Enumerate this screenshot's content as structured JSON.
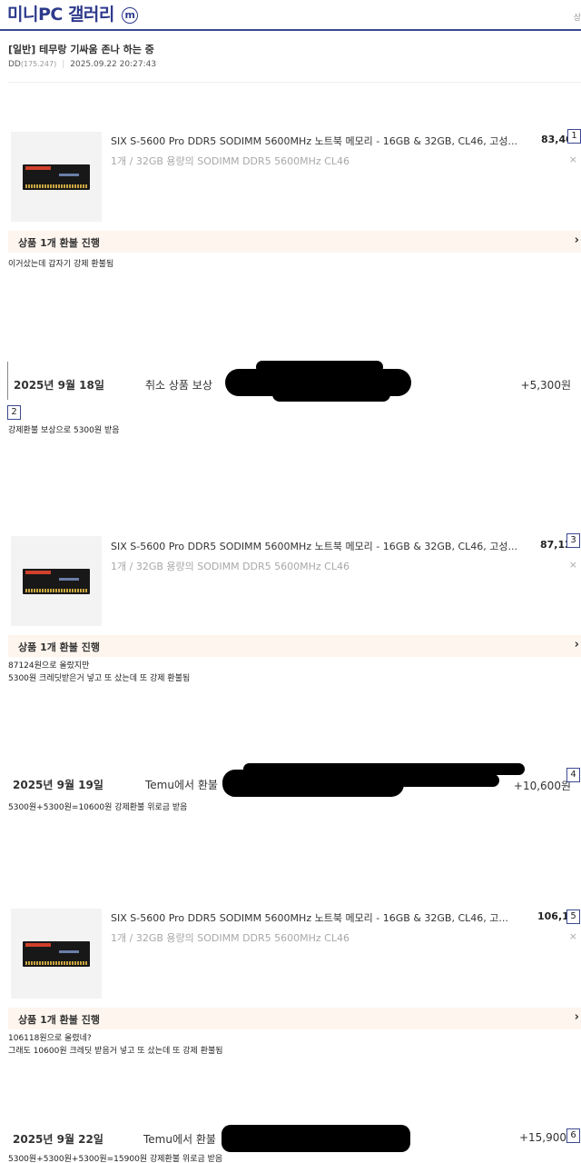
{
  "gallery": {
    "title": "미니PC 갤러리",
    "badge": "m",
    "edge_glyph": "상"
  },
  "post": {
    "title": "[일반] 테무랑 기싸움 존나 하는 중",
    "author": "DD",
    "ip": "(175.247)",
    "datetime": "2025.09.22 20:27:43"
  },
  "orders": [
    {
      "title": "SIX S-5600 Pro DDR5 SODIMM 5600MHz 노트북 메모리 - 16GB & 32GB, CL46, 고성...",
      "price": "83,40",
      "option": "1개 / 32GB 용량의 SODIMM DDR5 5600MHz CL46",
      "remove": "×",
      "marker": "1",
      "refund_label": "상품 1개 환불 진행",
      "chevron": "›"
    },
    {
      "title": "SIX S-5600 Pro DDR5 SODIMM 5600MHz 노트북 메모리 - 16GB & 32GB, CL46, 고성...",
      "price": "87,12",
      "option": "1개 / 32GB 용량의 SODIMM DDR5 5600MHz CL46",
      "remove": "×",
      "marker": "3",
      "refund_label": "상품 1개 환불 진행",
      "chevron": "›"
    },
    {
      "title": "SIX S-5600 Pro DDR5 SODIMM 5600MHz 노트북 메모리 - 16GB & 32GB, CL46, 고...",
      "price": "106,1",
      "option": "1개 / 32GB 용량의 SODIMM DDR5 5600MHz CL46",
      "remove": "×",
      "marker": "5",
      "refund_label": "상품 1개 환불 진행",
      "chevron": "›"
    }
  ],
  "captions": [
    "이거샀는데 갑자기 강제 환불됨",
    "강제환불 보상으로 5300원 받음",
    "87124원으로 올랐지만",
    "5300원 크레딧받은거 넣고 또 샀는데 또 강제 환불됨",
    "5300원+5300원=10600원 강제환불 위로금 받음",
    "106118원으로 올렸네?",
    "그래도 10600원 크레딧 받음거 넣고 또 샀는데 또 강제 환불됨",
    "5300원+5300원+5300원=15900원 강제환불 위로금 받음"
  ],
  "rewards": [
    {
      "date": "2025년 9월 18일",
      "label": "취소 상품 보상",
      "amount": "+5,300원",
      "marker": "2"
    },
    {
      "date": "2025년 9월 19일",
      "label": "Temu에서 환불",
      "amount": "+10,600원",
      "marker": "4"
    },
    {
      "date": "2025년 9월 22일",
      "label": "Temu에서 환불",
      "amount": "+15,900",
      "marker": "6"
    }
  ]
}
